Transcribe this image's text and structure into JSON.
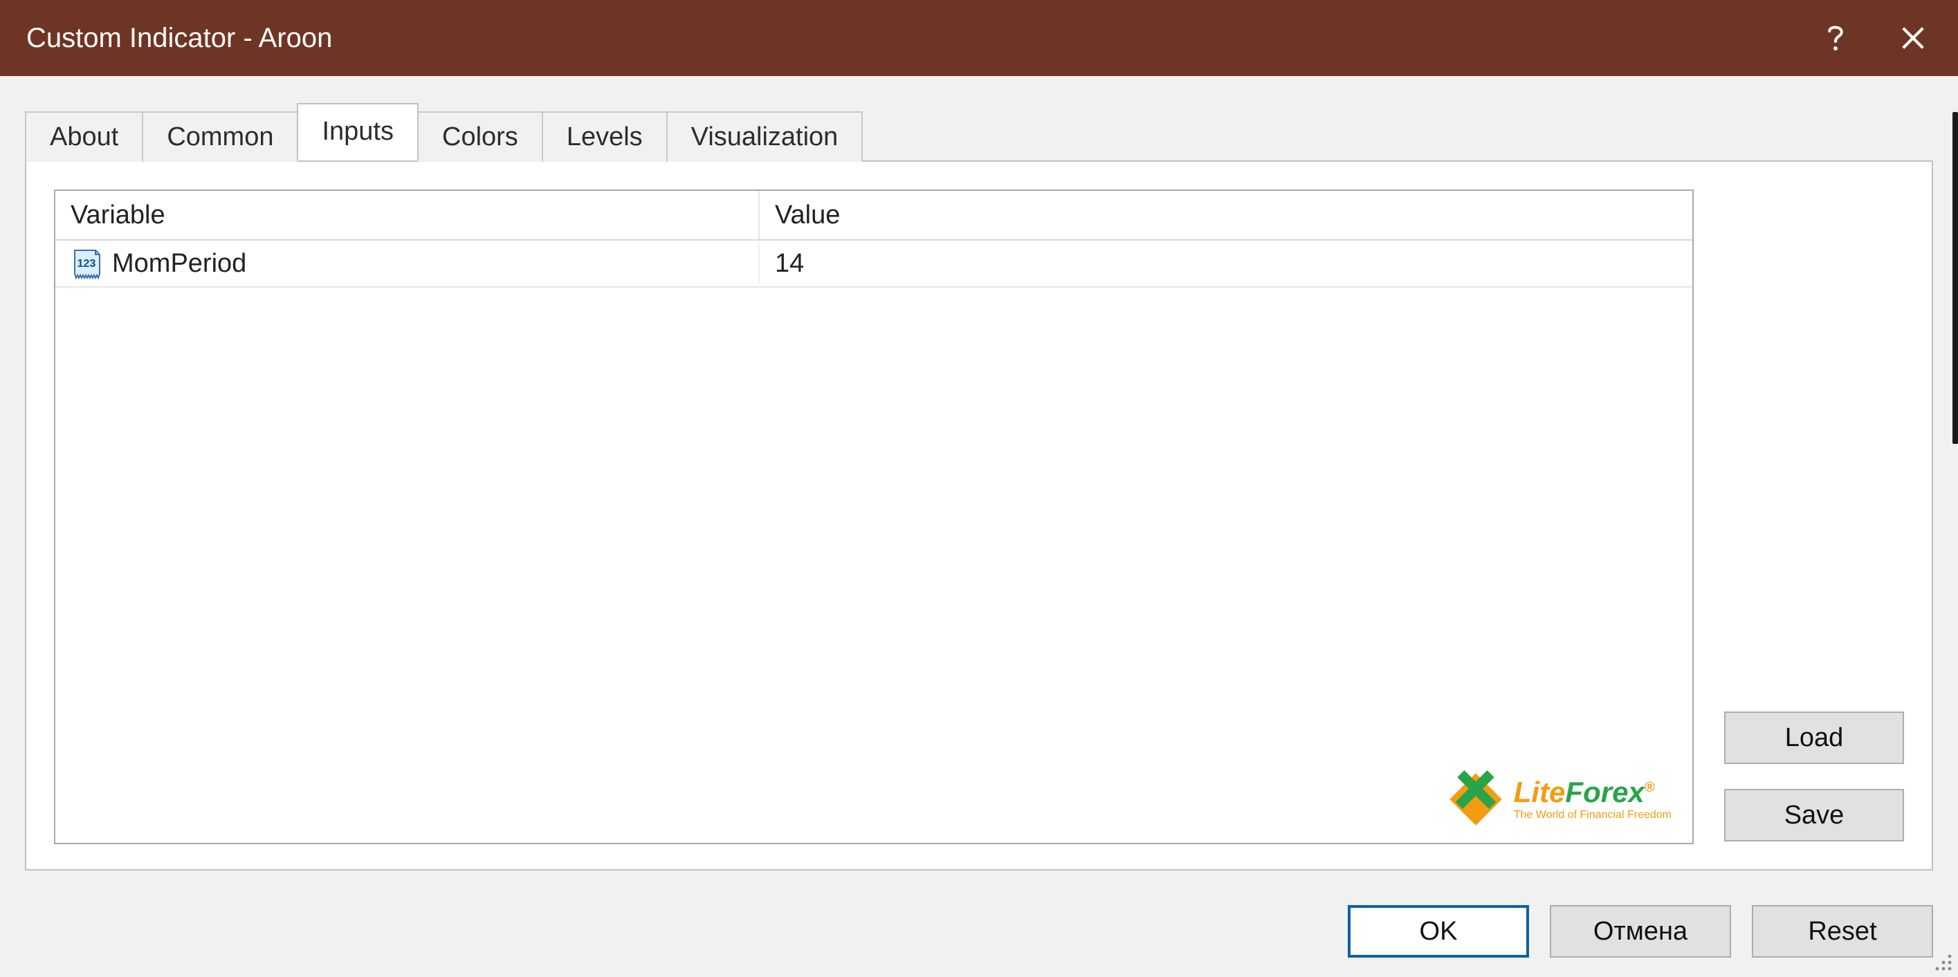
{
  "title": "Custom Indicator - Aroon",
  "tabs": [
    {
      "label": "About"
    },
    {
      "label": "Common"
    },
    {
      "label": "Inputs"
    },
    {
      "label": "Colors"
    },
    {
      "label": "Levels"
    },
    {
      "label": "Visualization"
    }
  ],
  "active_tab_index": 2,
  "table": {
    "headers": {
      "variable": "Variable",
      "value": "Value"
    },
    "rows": [
      {
        "icon": "integer-icon",
        "variable": "MomPeriod",
        "value": "14"
      }
    ]
  },
  "side_buttons": {
    "load": "Load",
    "save": "Save"
  },
  "footer_buttons": {
    "ok": "OK",
    "cancel": "Отмена",
    "reset": "Reset"
  },
  "watermark": {
    "brand_part1": "Lite",
    "brand_part2": "Forex",
    "registered": "®",
    "tagline": "The World of Financial Freedom"
  }
}
